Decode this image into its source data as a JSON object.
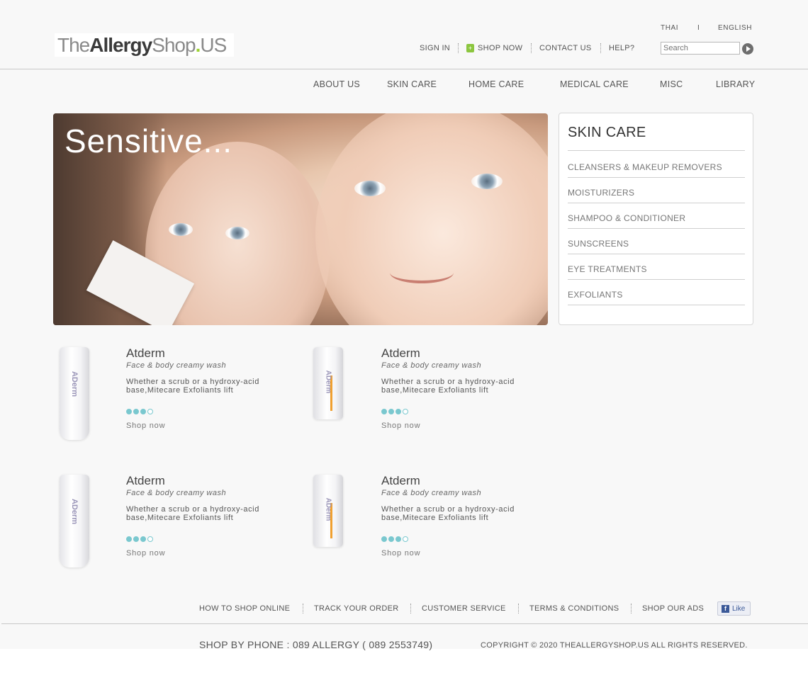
{
  "logo": {
    "part1": "The",
    "part2": "Allergy",
    "part3": "Shop",
    "dot": ".",
    "part4": "US"
  },
  "language": {
    "thai": "THAI",
    "divider": "I",
    "english": "ENGLISH"
  },
  "top_nav": {
    "sign_in": "SIGN IN",
    "shop_now": "SHOP NOW",
    "shop_icon": "shopping-bag-icon",
    "contact_us": "CONTACT US",
    "help": "HELP?"
  },
  "search": {
    "placeholder": "Search"
  },
  "main_nav": [
    "ABOUT US",
    "SKIN CARE",
    "HOME CARE",
    "MEDICAL CARE",
    "MISC",
    "LIBRARY"
  ],
  "hero": {
    "title": "Sensitive..."
  },
  "skin_care_panel": {
    "title": "SKIN CARE",
    "items": [
      "CLEANSERS & MAKEUP REMOVERS",
      "MOISTURIZERS",
      "SHAMPOO & CONDITIONER",
      "SUNSCREENS",
      "EYE TREATMENTS",
      "EXFOLIANTS"
    ]
  },
  "products": [
    {
      "name": "Atderm",
      "subtitle": "Face & body creamy wash",
      "description": "Whether a scrub or a hydroxy-acid base,Mitecare Exfoliants lift",
      "rating": 3,
      "rating_max": 4,
      "shop_label": "Shop now",
      "package_label": "ADerm",
      "package": "tube"
    },
    {
      "name": "Atderm",
      "subtitle": "Face & body creamy wash",
      "description": "Whether a scrub or a hydroxy-acid base,Mitecare Exfoliants lift",
      "rating": 3,
      "rating_max": 4,
      "shop_label": "Shop now",
      "package_label": "ADerm",
      "package": "bottle"
    },
    {
      "name": "Atderm",
      "subtitle": "Face & body creamy wash",
      "description": "Whether a scrub or a hydroxy-acid base,Mitecare Exfoliants lift",
      "rating": 3,
      "rating_max": 4,
      "shop_label": "Shop now",
      "package_label": "ADerm",
      "package": "tube"
    },
    {
      "name": "Atderm",
      "subtitle": "Face & body creamy wash",
      "description": "Whether a scrub or a hydroxy-acid base,Mitecare Exfoliants lift",
      "rating": 3,
      "rating_max": 4,
      "shop_label": "Shop now",
      "package_label": "ADerm",
      "package": "bottle"
    }
  ],
  "footer_nav": [
    "HOW TO SHOP ONLINE",
    "TRACK YOUR ORDER",
    "CUSTOMER SERVICE",
    "TERMS & CONDITIONS",
    "SHOP OUR ADS"
  ],
  "like_button": {
    "label": "Like",
    "icon": "facebook-icon",
    "glyph": "f"
  },
  "footer": {
    "phone": "SHOP BY PHONE : 089 ALLERGY ( 089 2553749)",
    "copyright": "COPYRIGHT © 2020 THEALLERGYSHOP.US  ALL RIGHTS RESERVED."
  },
  "colors": {
    "accent_green": "#8cc63f",
    "rating_teal": "#7ac8cf",
    "facebook_blue": "#3b5998"
  }
}
